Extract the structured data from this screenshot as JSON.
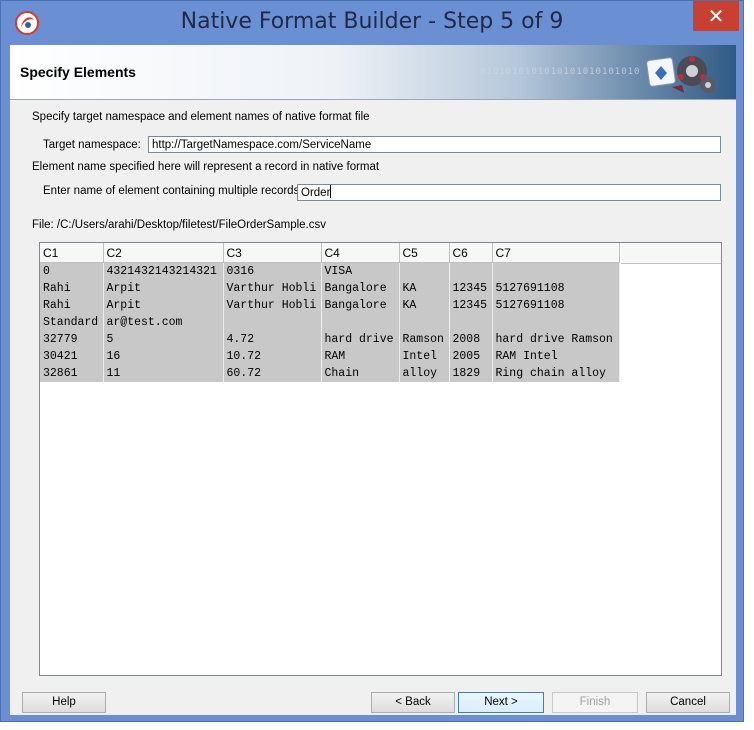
{
  "window": {
    "title": "Native Format Builder - Step 5 of 9",
    "close_symbol": "✕"
  },
  "header": {
    "title": "Specify Elements",
    "binary_text": "0101010101010101010101010"
  },
  "form": {
    "intro": "Specify target namespace and element names of native format file",
    "namespace_label": "Target namespace:",
    "namespace_value": "http://TargetNamespace.com/ServiceName",
    "element_note": "Element name specified here will represent a record in native format",
    "multi_label": "Enter name of element containing multiple records:",
    "multi_value": "Order",
    "file_label": "File: /C:/Users/arahi/Desktop/filetest/FileOrderSample.csv"
  },
  "grid": {
    "columns": [
      "C1",
      "C2",
      "C3",
      "C4",
      "C5",
      "C6",
      "C7"
    ],
    "rows": [
      [
        "0",
        "4321432143214321",
        "0316",
        "VISA",
        "",
        "",
        ""
      ],
      [
        "Rahi",
        "Arpit",
        "Varthur Hobli",
        "Bangalore",
        "KA",
        "12345",
        "5127691108"
      ],
      [
        "Rahi",
        "Arpit",
        "Varthur Hobli",
        "Bangalore",
        "KA",
        "12345",
        "5127691108"
      ],
      [
        "Standard",
        "ar@test.com",
        "",
        "",
        "",
        "",
        ""
      ],
      [
        "32779",
        "5",
        "4.72",
        "hard drive",
        "Ramson",
        "2008",
        "hard drive Ramson"
      ],
      [
        "30421",
        "16",
        "10.72",
        "RAM",
        "Intel",
        "2005",
        "RAM Intel"
      ],
      [
        "32861",
        "11",
        "60.72",
        "Chain",
        "alloy",
        "1829",
        "Ring chain alloy"
      ]
    ]
  },
  "buttons": {
    "help": "Help",
    "back": "< Back",
    "next": "Next >",
    "finish": "Finish",
    "cancel": "Cancel"
  },
  "icons": {
    "app": "oracle-app-icon",
    "wizard": "wizard-gear-icon"
  },
  "colors": {
    "titlebar": "#6b8fd3",
    "close": "#c84031",
    "grid_cell": "#c8c8c8"
  }
}
